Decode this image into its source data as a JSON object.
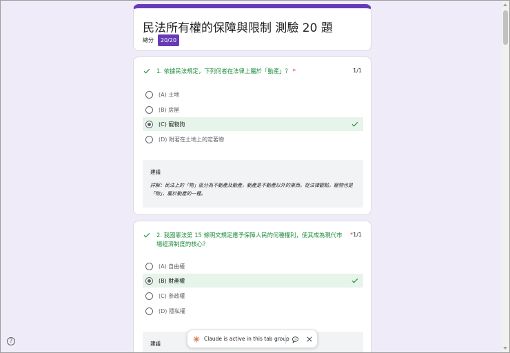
{
  "header": {
    "title": "民法所有權的保障與限制 測驗 20 題",
    "score_label": "總分",
    "score_value": "20/20",
    "accent_color": "#673ab7"
  },
  "questions": [
    {
      "number_text": "1. 依據民法規定，下列何者在法律上屬於「動產」？",
      "required_mark": "*",
      "points": "1/1",
      "options": [
        {
          "label": "(A) 土地",
          "selected": false,
          "correct": false
        },
        {
          "label": "(B) 房屋",
          "selected": false,
          "correct": false
        },
        {
          "label": "(C) 寵物狗",
          "selected": true,
          "correct": true
        },
        {
          "label": "(D) 附著在土地上的定著物",
          "selected": false,
          "correct": false
        }
      ],
      "feedback_title": "建議",
      "feedback_text": "詳解：民法上的「物」區分為不動產及動產，動產是不動產以外的東西。從法律觀點，寵物也是「物」，屬於動產的一種。"
    },
    {
      "number_text": "2. 我國憲法第 15 條明文規定應予保障人民的何種權利，使其成為現代市場經濟制度的核心？",
      "required_mark": "*",
      "points": "1/1",
      "options": [
        {
          "label": "(A) 自由權",
          "selected": false,
          "correct": false
        },
        {
          "label": "(B) 財產權",
          "selected": true,
          "correct": true
        },
        {
          "label": "(C) 參政權",
          "selected": false,
          "correct": false
        },
        {
          "label": "(D) 隱私權",
          "selected": false,
          "correct": false
        }
      ],
      "feedback_title": "建議"
    }
  ],
  "colors": {
    "correct_green": "#1e8e3e",
    "correct_bg": "#e6f4ea",
    "required_red": "#d93025",
    "page_bg": "#efebf8"
  },
  "help": {
    "label": "?"
  },
  "toast": {
    "text": "Claude is active in this tab group",
    "icons": [
      "claude-logo-icon",
      "chat-bubble-icon",
      "close-icon"
    ]
  }
}
